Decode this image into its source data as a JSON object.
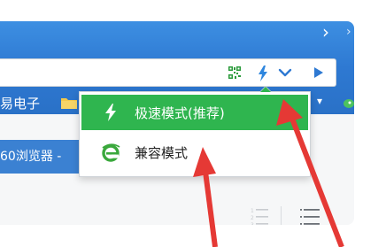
{
  "title_bar": {
    "chevron": "›",
    "chevron_secondary": "›"
  },
  "address_bar": {
    "icons": [
      "qr-code-icon",
      "lightning-icon",
      "chevron-down-icon",
      "play-icon"
    ]
  },
  "bookmarks_bar": {
    "left_text": "易电子",
    "overflow_chevron": "▾"
  },
  "tab": {
    "label": "60浏览器 -"
  },
  "mode_menu": {
    "items": [
      {
        "label": "极速模式(推荐)",
        "icon": "lightning-icon",
        "selected": true
      },
      {
        "label": "兼容模式",
        "icon": "ie-icon",
        "selected": false
      }
    ]
  },
  "annotations": {
    "arrow_color": "#e53935"
  },
  "colors": {
    "accent_blue": "#2e79d2",
    "menu_selected_green": "#2fb54f",
    "ie_icon_green": "#3aa83c"
  }
}
